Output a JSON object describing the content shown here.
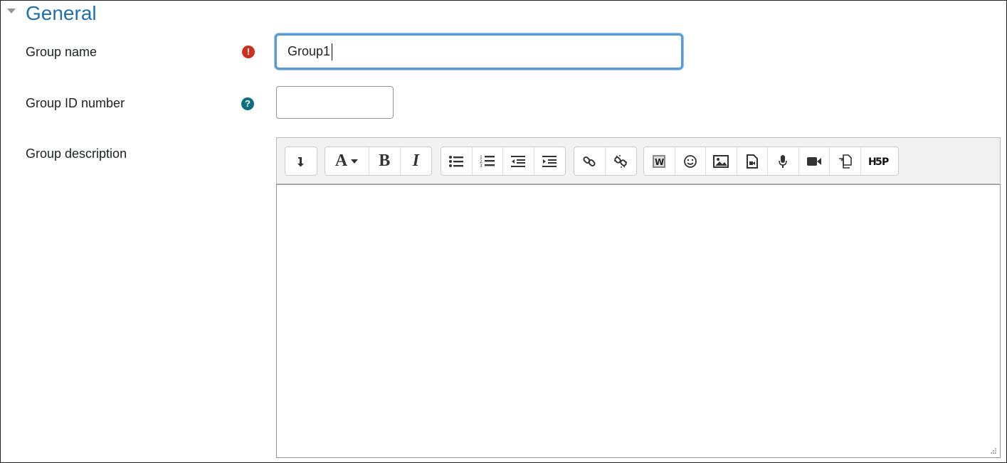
{
  "section": {
    "title": "General",
    "toggle_icon": "caret-down-icon"
  },
  "fields": {
    "group_name": {
      "label": "Group name",
      "value": "Group1",
      "status_icon": "required-icon"
    },
    "group_id": {
      "label": "Group ID number",
      "value": "",
      "status_icon": "help-icon"
    },
    "group_description": {
      "label": "Group description",
      "value": ""
    }
  },
  "toolbar": {
    "groups": [
      [
        "show-more-icon"
      ],
      [
        "font-style-icon",
        "bold-icon",
        "italic-icon"
      ],
      [
        "unordered-list-icon",
        "ordered-list-icon",
        "outdent-icon",
        "indent-icon"
      ],
      [
        "link-icon",
        "unlink-icon"
      ],
      [
        "word-import-icon",
        "emoji-icon",
        "image-icon",
        "media-icon",
        "record-audio-icon",
        "record-video-icon",
        "copy-paste-icon",
        "h5p-icon"
      ]
    ]
  },
  "colors": {
    "title": "#1f6fb2",
    "required": "#ca3120",
    "help": "#0f6e80",
    "focus_border": "#5b9bd5"
  }
}
